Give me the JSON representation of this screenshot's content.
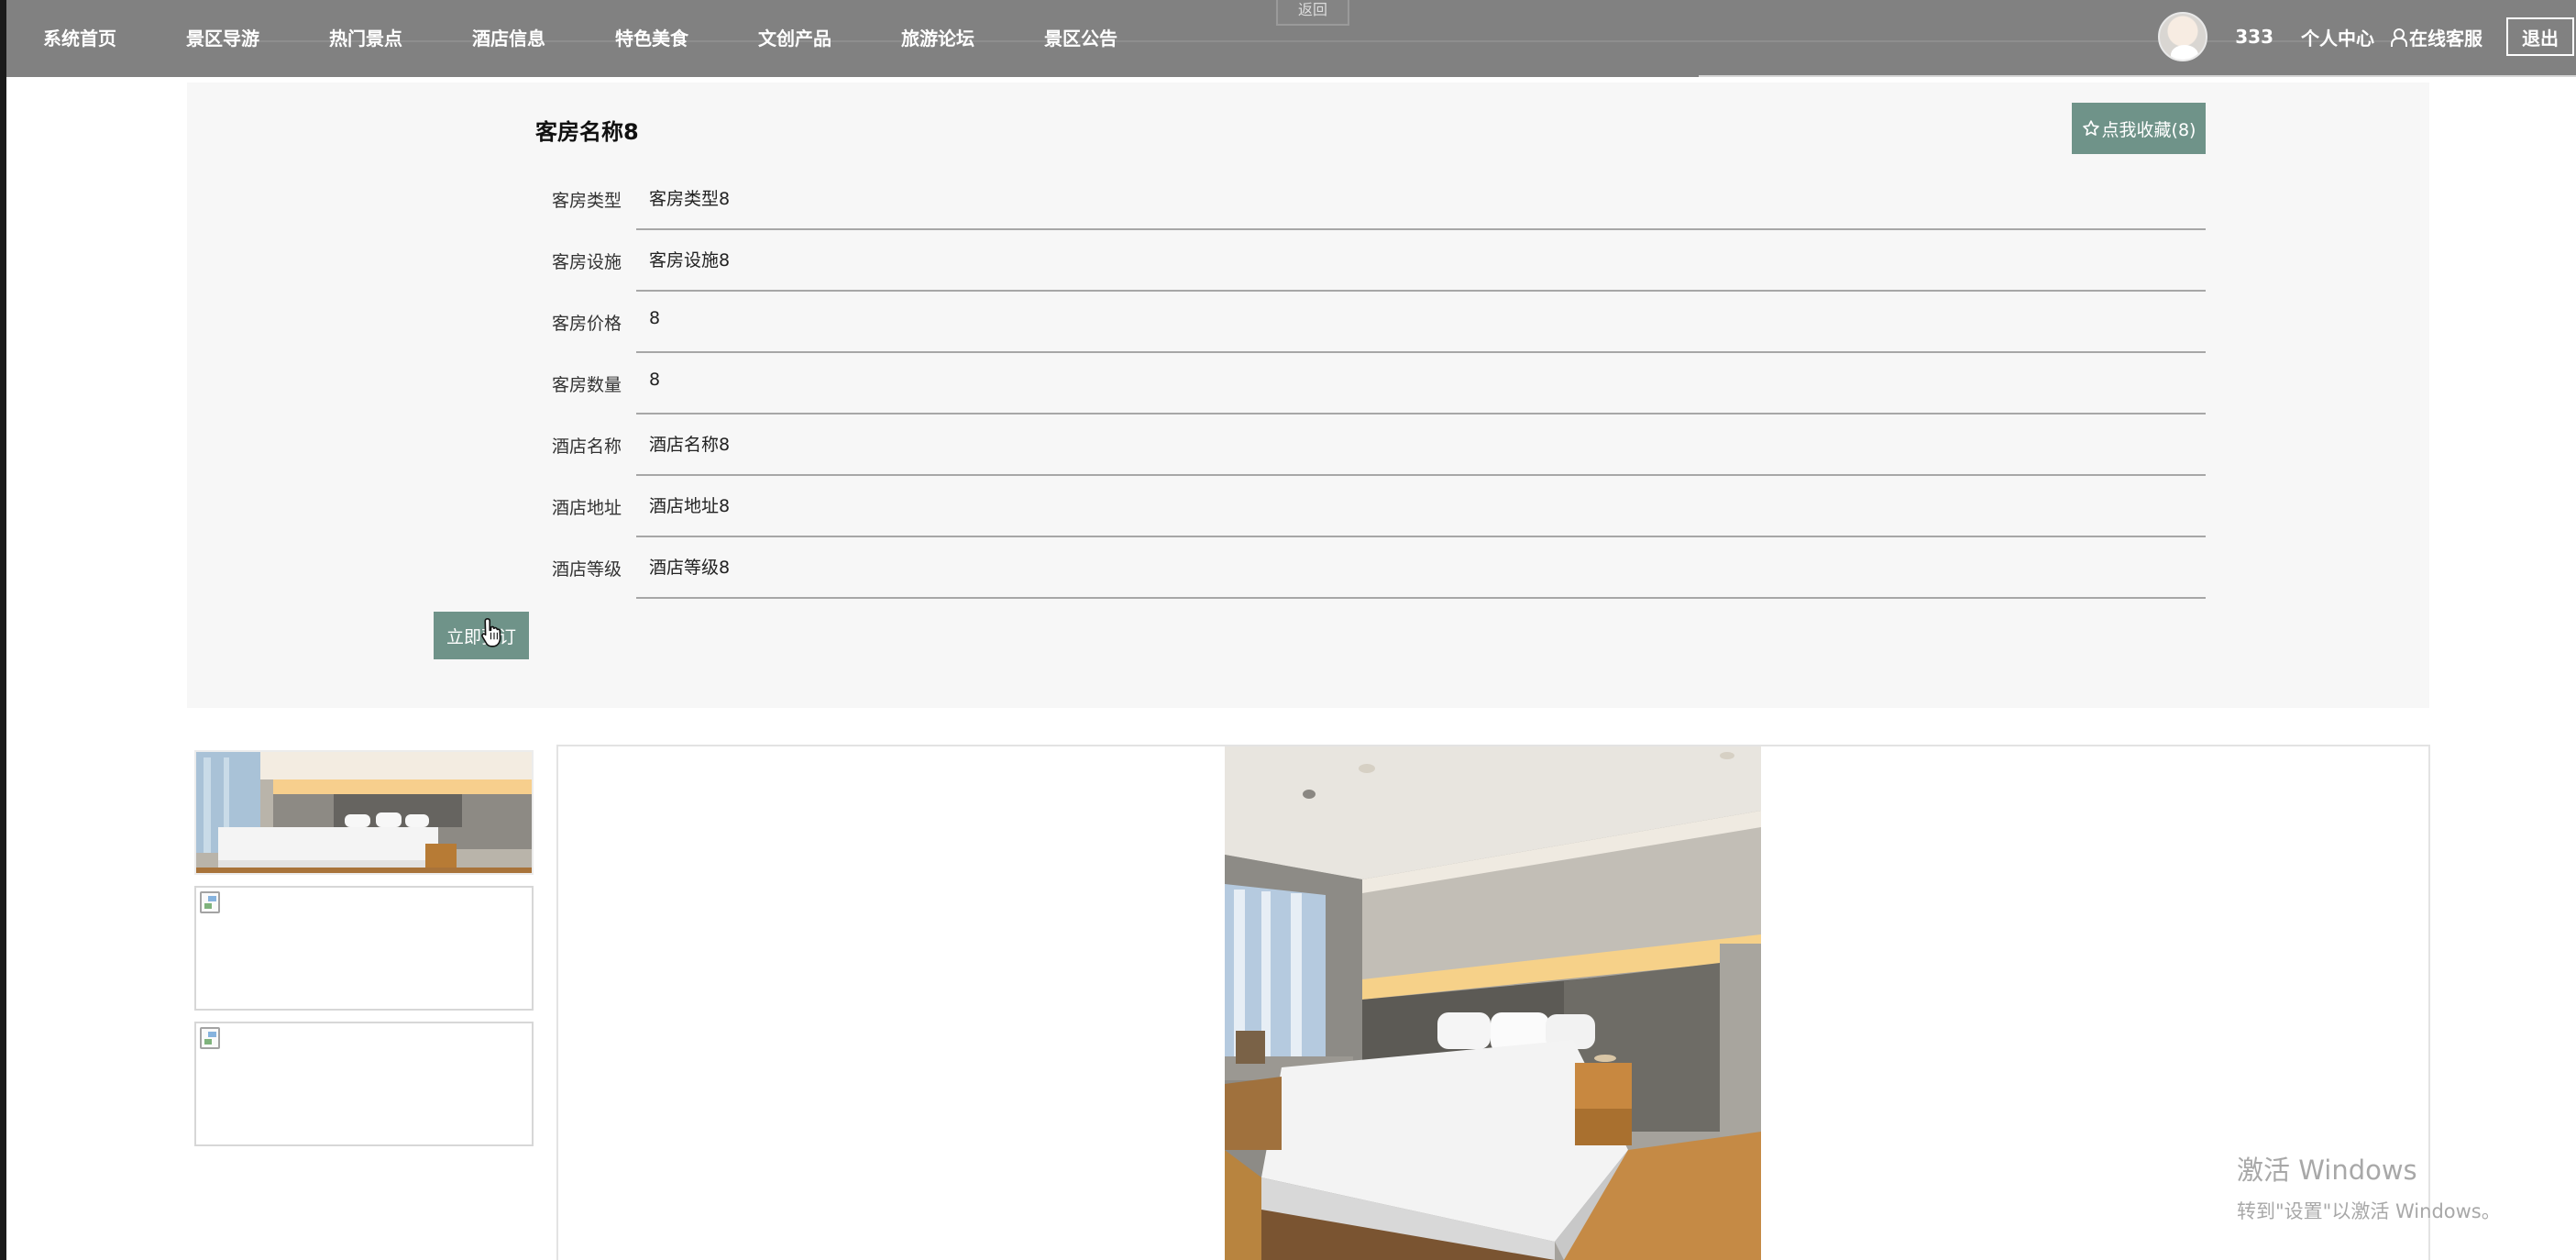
{
  "nav": {
    "items": [
      "系统首页",
      "景区导游",
      "热门景点",
      "酒店信息",
      "特色美食",
      "文创产品",
      "旅游论坛",
      "景区公告"
    ],
    "back_label": "返回"
  },
  "user": {
    "name": "333",
    "center_label": "个人中心",
    "service_label": "在线客服",
    "logout_label": "退出"
  },
  "room": {
    "title": "客房名称8",
    "favorite_label": "点我收藏(8)",
    "fields": [
      {
        "label": "客房类型",
        "value": "客房类型8"
      },
      {
        "label": "客房设施",
        "value": "客房设施8"
      },
      {
        "label": "客房价格",
        "value": "8"
      },
      {
        "label": "客房数量",
        "value": "8"
      },
      {
        "label": "酒店名称",
        "value": "酒店名称8"
      },
      {
        "label": "酒店地址",
        "value": "酒店地址8"
      },
      {
        "label": "酒店等级",
        "value": "酒店等级8"
      }
    ],
    "book_label": "立即预订"
  },
  "watermark": {
    "title": "激活 Windows",
    "subtitle": "转到\"设置\"以激活 Windows。"
  },
  "colors": {
    "nav_bg": "#818181",
    "accent": "#6f9389",
    "panel_bg": "#f7f7f7"
  }
}
